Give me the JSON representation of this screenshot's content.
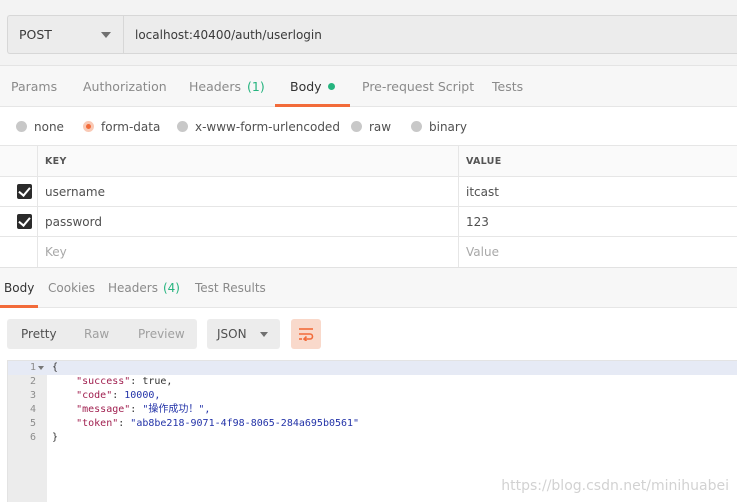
{
  "request": {
    "method": "POST",
    "url": "localhost:40400/auth/userlogin"
  },
  "request_tabs": [
    {
      "label": "Params",
      "count": ""
    },
    {
      "label": "Authorization",
      "count": ""
    },
    {
      "label": "Headers",
      "count": "(1)"
    },
    {
      "label": "Body",
      "count": ""
    },
    {
      "label": "Pre-request Script",
      "count": ""
    },
    {
      "label": "Tests",
      "count": ""
    }
  ],
  "body_types": [
    "none",
    "form-data",
    "x-www-form-urlencoded",
    "raw",
    "binary"
  ],
  "form_table": {
    "headers": {
      "key": "KEY",
      "value": "VALUE"
    },
    "rows": [
      {
        "key": "username",
        "value": "itcast"
      },
      {
        "key": "password",
        "value": "123"
      }
    ],
    "placeholder": {
      "key": "Key",
      "value": "Value"
    }
  },
  "response_tabs": [
    {
      "label": "Body",
      "count": ""
    },
    {
      "label": "Cookies",
      "count": ""
    },
    {
      "label": "Headers",
      "count": "(4)"
    },
    {
      "label": "Test Results",
      "count": ""
    }
  ],
  "view_modes": [
    "Pretty",
    "Raw",
    "Preview"
  ],
  "format": "JSON",
  "code": {
    "line_numbers": [
      "1",
      "2",
      "3",
      "4",
      "5",
      "6"
    ],
    "open_brace": "{",
    "close_brace": "}",
    "fields": [
      {
        "key": "\"success\"",
        "value": "true,"
      },
      {
        "key": "\"code\"",
        "value": "10000,"
      },
      {
        "key": "\"message\"",
        "value": "\"操作成功！\","
      },
      {
        "key": "\"token\"",
        "value": "\"ab8be218-9071-4f98-8065-284a695b0561\""
      }
    ]
  },
  "watermark": "https://blog.csdn.net/minihuabei",
  "colors": {
    "accent": "#f26b3a",
    "count": "#26b47f"
  }
}
